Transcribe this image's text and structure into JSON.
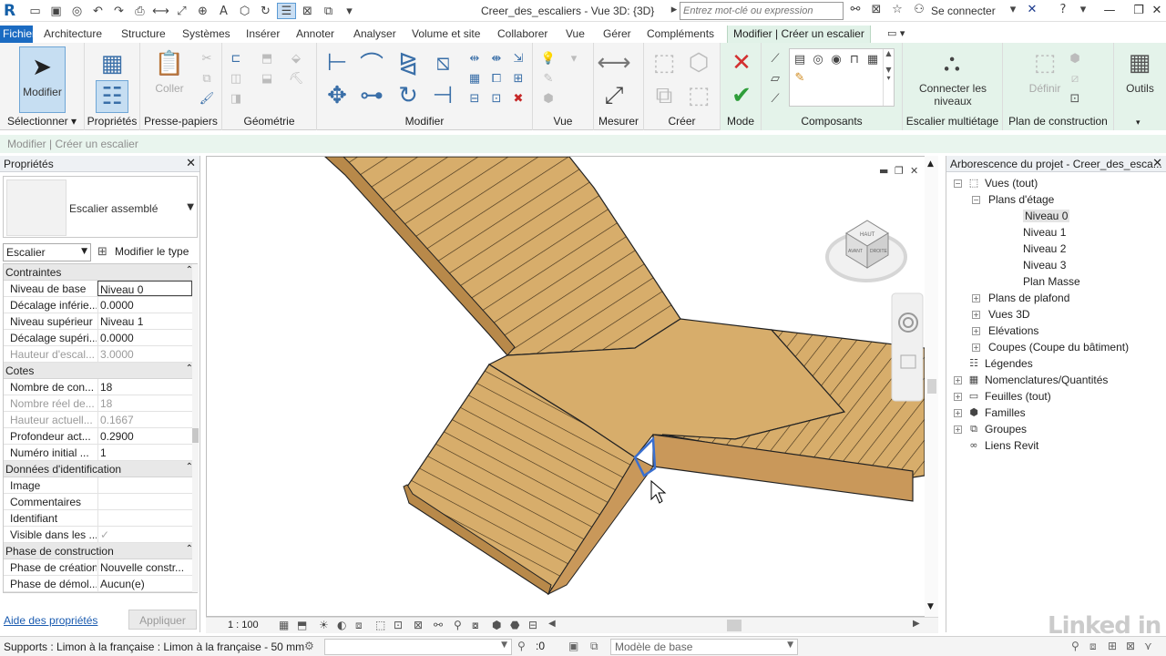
{
  "titlebar": {
    "logo": "R",
    "document_title": "Creer_des_escaliers - Vue 3D: {3D}",
    "search_placeholder": "Entrez mot-clé ou expression",
    "signin": "Se connecter"
  },
  "tabs": [
    "Fichier",
    "Architecture",
    "Structure",
    "Systèmes",
    "Insérer",
    "Annoter",
    "Analyser",
    "Volume et site",
    "Collaborer",
    "Vue",
    "Gérer",
    "Compléments",
    "Modifier | Créer un escalier"
  ],
  "ribbon": {
    "modify_label": "Modifier",
    "paste_label": "Coller",
    "connect_levels_label": "Connecter les niveaux",
    "define_label": "Définir",
    "tools_label": "Outils",
    "panels": {
      "select": "Sélectionner",
      "properties": "Propriétés",
      "clipboard": "Presse-papiers",
      "geometry": "Géométrie",
      "modify": "Modifier",
      "view": "Vue",
      "measure": "Mesurer",
      "create": "Créer",
      "mode": "Mode",
      "components": "Composants",
      "multistory": "Escalier multiétage",
      "work_plane": "Plan de construction"
    }
  },
  "options_bar": {
    "context": "Modifier | Créer un escalier"
  },
  "properties": {
    "title": "Propriétés",
    "type_name": "Escalier assemblé",
    "category": "Escalier",
    "edit_type": "Modifier le type",
    "groups": [
      {
        "name": "Contraintes",
        "rows": [
          {
            "name": "Niveau de base",
            "value": "Niveau 0"
          },
          {
            "name": "Décalage inférie...",
            "value": "0.0000"
          },
          {
            "name": "Niveau supérieur",
            "value": "Niveau 1"
          },
          {
            "name": "Décalage supéri...",
            "value": "0.0000"
          },
          {
            "name": "Hauteur d'escal...",
            "value": "3.0000"
          }
        ]
      },
      {
        "name": "Cotes",
        "rows": [
          {
            "name": "Nombre de con...",
            "value": "18"
          },
          {
            "name": "Nombre réel de...",
            "value": "18"
          },
          {
            "name": "Hauteur actuell...",
            "value": "0.1667"
          },
          {
            "name": "Profondeur act...",
            "value": "0.2900"
          },
          {
            "name": "Numéro initial ...",
            "value": "1"
          }
        ]
      },
      {
        "name": "Données d'identification",
        "rows": [
          {
            "name": "Image",
            "value": ""
          },
          {
            "name": "Commentaires",
            "value": ""
          },
          {
            "name": "Identifiant",
            "value": ""
          },
          {
            "name": "Visible dans les ...",
            "value": "✓"
          }
        ]
      },
      {
        "name": "Phase de construction",
        "rows": [
          {
            "name": "Phase de création",
            "value": "Nouvelle constr..."
          },
          {
            "name": "Phase de démol...",
            "value": "Aucun(e)"
          }
        ]
      }
    ],
    "help_link": "Aide des propriétés",
    "apply": "Appliquer"
  },
  "view": {
    "viewcube_top": "HAUT",
    "viewcube_front": "AVANT",
    "viewcube_right": "DROITE",
    "scale": "1 : 100"
  },
  "browser": {
    "title": "Arborescence du projet - Creer_des_esca...",
    "tree": [
      {
        "label": "Vues (tout)",
        "level": 0,
        "toggle": "−",
        "icon": "view-icon"
      },
      {
        "label": "Plans d'étage",
        "level": 1,
        "toggle": "−"
      },
      {
        "label": "Niveau 0",
        "level": 2,
        "selected": true
      },
      {
        "label": "Niveau 1",
        "level": 2
      },
      {
        "label": "Niveau 2",
        "level": 2
      },
      {
        "label": "Niveau 3",
        "level": 2
      },
      {
        "label": "Plan Masse",
        "level": 2
      },
      {
        "label": "Plans de plafond",
        "level": 1,
        "toggle": "+"
      },
      {
        "label": "Vues 3D",
        "level": 1,
        "toggle": "+"
      },
      {
        "label": "Elévations",
        "level": 1,
        "toggle": "+"
      },
      {
        "label": "Coupes (Coupe du bâtiment)",
        "level": 1,
        "toggle": "+"
      },
      {
        "label": "Légendes",
        "level": 0,
        "icon": "legend-icon"
      },
      {
        "label": "Nomenclatures/Quantités",
        "level": 0,
        "toggle": "+",
        "icon": "schedule-icon"
      },
      {
        "label": "Feuilles (tout)",
        "level": 0,
        "toggle": "+",
        "icon": "sheet-icon"
      },
      {
        "label": "Familles",
        "level": 0,
        "toggle": "+",
        "icon": "family-icon"
      },
      {
        "label": "Groupes",
        "level": 0,
        "toggle": "+",
        "icon": "group-icon"
      },
      {
        "label": "Liens Revit",
        "level": 0,
        "icon": "link-icon"
      }
    ]
  },
  "statusbar": {
    "text": "Supports : Limon à la française : Limon à la française - 50 mm",
    "coord": ":0",
    "model": "Modèle de base"
  },
  "watermark": "Linked in"
}
